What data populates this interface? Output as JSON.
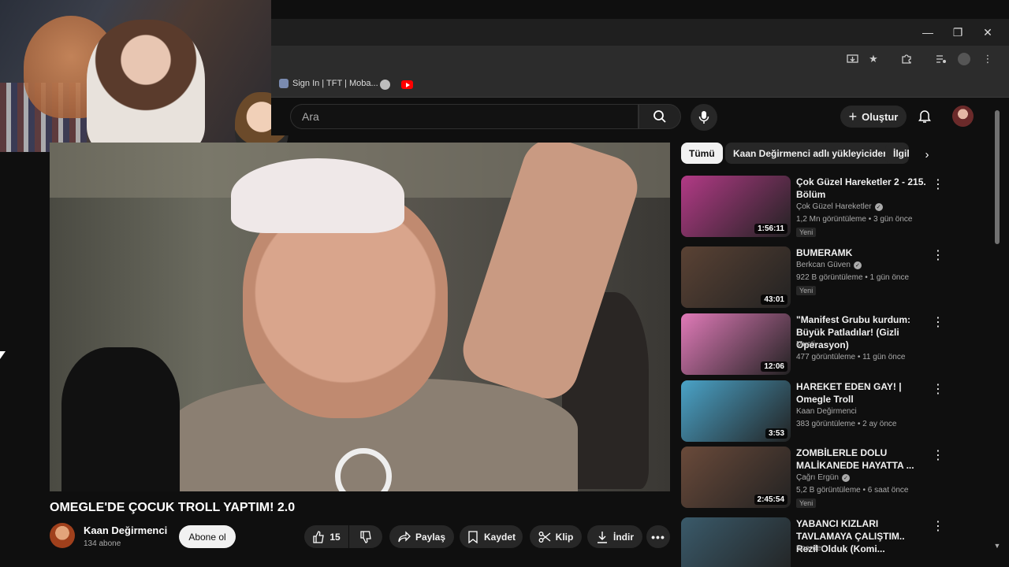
{
  "bookmarks": {
    "item1_label": "Sign In | TFT | Moba...",
    "item1_icon": "game-icon",
    "item2_icon": "globe-icon",
    "item3_icon": "youtube-icon"
  },
  "window_controls": {
    "minimize": "—",
    "restore": "❐",
    "close": "✕"
  },
  "header": {
    "search_placeholder": "Ara",
    "create_label": "Oluştur"
  },
  "video": {
    "title": "OMEGLE'DE ÇOCUK TROLL YAPTIM! 2.0",
    "channel": "Kaan Değirmenci",
    "subscribers": "134 abone",
    "subscribe_label": "Abone ol",
    "likes": "15",
    "share_label": "Paylaş",
    "save_label": "Kaydet",
    "clip_label": "Klip",
    "download_label": "İndir"
  },
  "chips": [
    "Tümü",
    "Kaan Değirmenci adlı yükleyiciden",
    "İlgili"
  ],
  "recommendations": [
    {
      "title": "Çok Güzel Hareketler 2 - 215. Bölüm",
      "channel": "Çok Güzel Hareketler",
      "verified": true,
      "meta": "1,2 Mn görüntüleme • 3 gün önce",
      "badge": "Yeni",
      "duration": "1:56:11",
      "thumb_color": "#b23a86"
    },
    {
      "title": "BUMERAMK",
      "channel": "Berkcan Güven",
      "verified": true,
      "meta": "922 B görüntüleme • 1 gün önce",
      "badge": "Yeni",
      "duration": "43:01",
      "thumb_color": "#5a4234"
    },
    {
      "title": "\"Manifest Grubu kurdum: Büyük Patladılar! (Gizli Operasyon)",
      "channel": "Musti",
      "verified": false,
      "meta": "477 görüntüleme • 11 gün önce",
      "badge": "",
      "duration": "12:06",
      "thumb_color": "#e07ab8"
    },
    {
      "title": "HAREKET EDEN GAY! | Omegle Troll",
      "channel": "Kaan Değirmenci",
      "verified": false,
      "meta": "383 görüntüleme • 2 ay önce",
      "badge": "",
      "duration": "3:53",
      "thumb_color": "#4aa3c8"
    },
    {
      "title": "ZOMBİLERLE DOLU MALİKANEDE HAYATTA ...",
      "channel": "Çağrı Ergün",
      "verified": true,
      "meta": "5,2 B görüntüleme • 6 saat önce",
      "badge": "Yeni",
      "duration": "2:45:54",
      "thumb_color": "#6a4a3a"
    },
    {
      "title": "YABANCI KIZLARI TAVLAMAYA ÇALIŞTIM.. Rezil Olduk (Komi...",
      "channel": "Scarder",
      "verified": false,
      "meta": "",
      "badge": "",
      "duration": "",
      "thumb_color": "#3a5a6a"
    }
  ]
}
